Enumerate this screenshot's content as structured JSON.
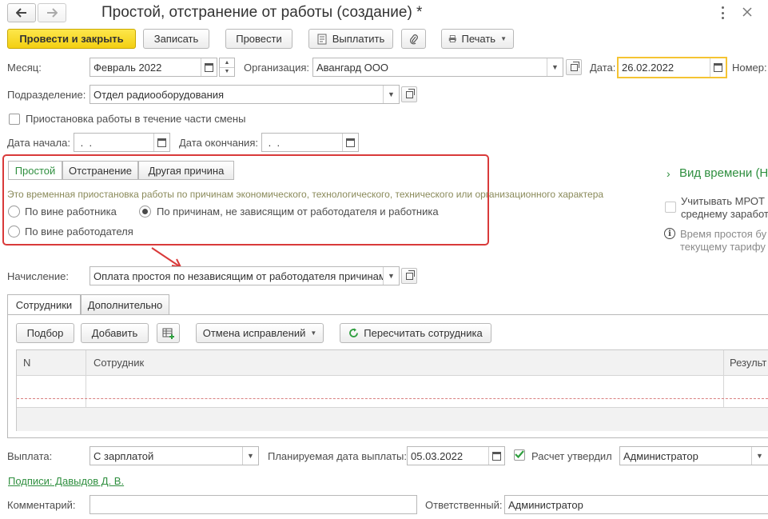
{
  "window": {
    "title": "Простой, отстранение от работы (создание) *"
  },
  "toolbar": {
    "post_close": "Провести и закрыть",
    "save": "Записать",
    "post": "Провести",
    "pay": "Выплатить",
    "print": "Печать"
  },
  "header": {
    "month_label": "Месяц:",
    "month_value": "Февраль 2022",
    "org_label": "Организация:",
    "org_value": "Авангард ООО",
    "date_label": "Дата:",
    "date_value": "26.02.2022",
    "number_label": "Номер:",
    "dept_label": "Подразделение:",
    "dept_value": "Отдел радиооборудования",
    "partial_shift_label": "Приостановка работы в течение части смены",
    "start_label": "Дата начала:",
    "start_value": " .  .",
    "end_label": "Дата окончания:",
    "end_value": " .  ."
  },
  "reason_tabs": [
    {
      "label": "Простой"
    },
    {
      "label": "Отстранение"
    },
    {
      "label": "Другая причина"
    }
  ],
  "reason": {
    "description": "Это временная приостановка работы по причинам экономического, технологического, технического или организационного характера",
    "opt_employee": "По вине работника",
    "opt_independent": "По причинам, не зависящим от работодателя и работника",
    "opt_employer": "По вине работодателя"
  },
  "time_type": {
    "heading": "Вид времени (Н",
    "mrot_line1": "Учитывать МРОТ п",
    "mrot_line2": "среднему заработ",
    "info_line1": "Время простоя бу",
    "info_line2": "текущему тарифу"
  },
  "accrual": {
    "label": "Начисление:",
    "value": "Оплата простоя по независящим от работодателя причинам"
  },
  "content_tabs": [
    {
      "label": "Сотрудники"
    },
    {
      "label": "Дополнительно"
    }
  ],
  "table_toolbar": {
    "pick": "Подбор",
    "add": "Добавить",
    "cancel_fix": "Отмена исправлений",
    "recalc": "Пересчитать сотрудника"
  },
  "table": {
    "col_n": "N",
    "col_employee": "Сотрудник",
    "col_result": "Результ"
  },
  "footer": {
    "payment_label": "Выплата:",
    "payment_value": "С зарплатой",
    "planned_label": "Планируемая дата выплаты:",
    "planned_value": "05.03.2022",
    "approved_label": "Расчет утвердил",
    "approved_value": "Администратор",
    "signatures": "Подписи: Давыдов Д. В.",
    "comment_label": "Комментарий:",
    "responsible_label": "Ответственный:",
    "responsible_value": "Администратор"
  },
  "colors": {
    "accent_green": "#2f8f3f",
    "primary_yellow": "#f3cf12",
    "focus_orange": "#f5c433",
    "highlight_red": "#d93a3a"
  }
}
